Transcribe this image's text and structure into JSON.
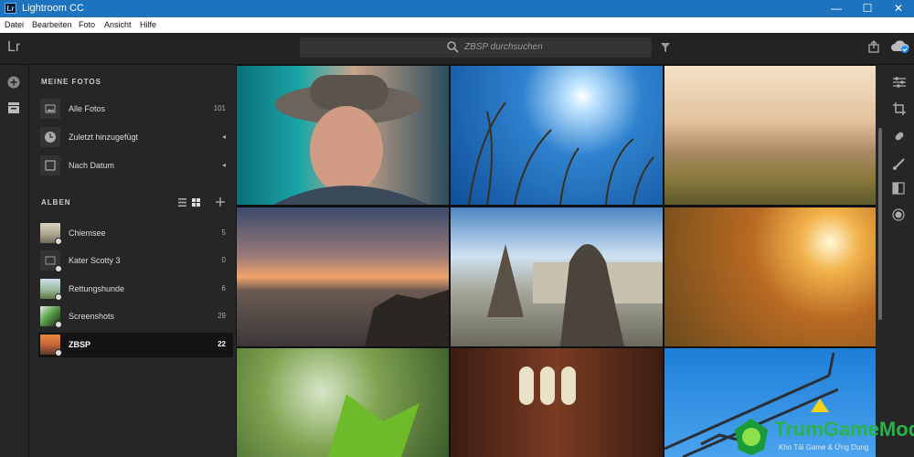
{
  "window": {
    "app_logo": "Lr",
    "title": "Lightroom CC",
    "minimize": "—",
    "maximize": "☐",
    "close": "✕"
  },
  "menu": {
    "items": [
      "Datei",
      "Bearbeiten",
      "Foto",
      "Ansicht",
      "Hilfe"
    ]
  },
  "toolbar": {
    "logo": "Lr",
    "search_placeholder": "ZBSP durchsuchen"
  },
  "sidebar": {
    "my_photos_heading": "MEINE FOTOS",
    "my_photos": [
      {
        "label": "Alle Fotos",
        "count": "101",
        "icon": "photo-icon"
      },
      {
        "label": "Zuletzt hinzugefügt",
        "count": "◂",
        "icon": "clock-icon"
      },
      {
        "label": "Nach Datum",
        "count": "◂",
        "icon": "calendar-icon"
      }
    ],
    "albums_heading": "ALBEN",
    "albums": [
      {
        "label": "Chiemsee",
        "count": "5"
      },
      {
        "label": "Kater Scotty 3",
        "count": "0"
      },
      {
        "label": "Rettungshunde",
        "count": "6"
      },
      {
        "label": "Screenshots",
        "count": "29"
      },
      {
        "label": "ZBSP",
        "count": "22",
        "active": true
      }
    ]
  },
  "photos": [
    {
      "name": "man-with-hat"
    },
    {
      "name": "reeds-against-sun"
    },
    {
      "name": "misty-hills"
    },
    {
      "name": "lake-sunset-stones"
    },
    {
      "name": "statue-fountain-palace"
    },
    {
      "name": "backlit-grass-sun"
    },
    {
      "name": "green-leaf-bokeh"
    },
    {
      "name": "wooden-interior-windows"
    },
    {
      "name": "steel-truss-blue-sky"
    }
  ],
  "watermark": {
    "brand": "TrumGameMod",
    "tagline": "Kho Tải Game & Ứng Dụng"
  },
  "colors": {
    "accent": "#1e73be",
    "panel": "#262626",
    "active_item": "#141414"
  }
}
